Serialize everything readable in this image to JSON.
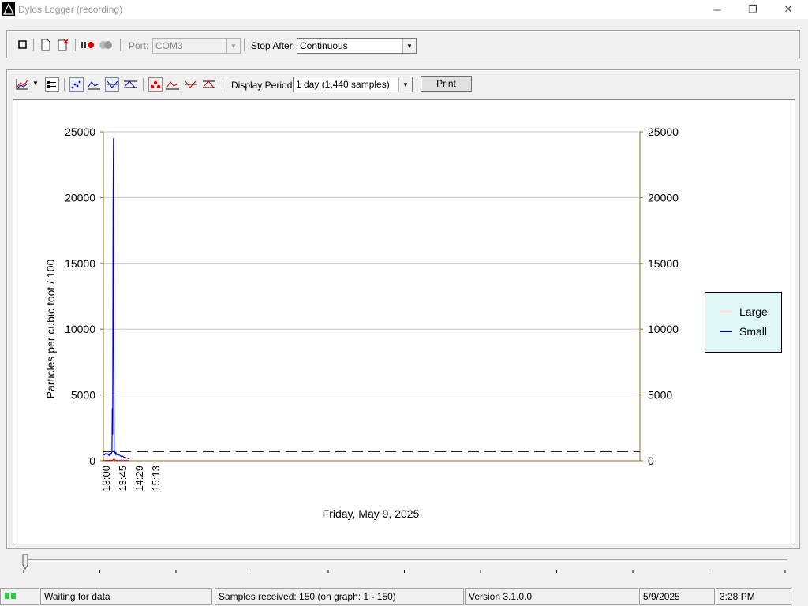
{
  "window": {
    "title": "Dylos Logger (recording)",
    "minimize_glyph": "─",
    "restore_glyph": "❐",
    "close_glyph": "✕"
  },
  "toolbar1": {
    "port_label": "Port:",
    "port_value": "COM3",
    "stop_after_label": "Stop After:",
    "stop_after_value": "Continuous",
    "icons": [
      "stop-icon",
      "new-file-icon",
      "delete-file-icon",
      "record-pause-icon",
      "connect-icon"
    ]
  },
  "toolbar2": {
    "display_period_label": "Display Period:",
    "display_period_value": "1 day (1,440 samples)",
    "print_label": "Print",
    "icons": [
      "chart-type-icon",
      "legend-icon",
      "scatter-blue-icon",
      "line-blue-icon",
      "line-blue-alt-icon",
      "line-blue-both-icon",
      "scatter-red-icon",
      "line-red-icon",
      "line-red-alt-icon",
      "line-red-both-icon"
    ]
  },
  "chart_data": {
    "type": "line",
    "ylabel": "Particles per cubic foot / 100",
    "xlabel": "Friday, May 9, 2025",
    "ylim": [
      0,
      25000
    ],
    "y_ticks": [
      0,
      5000,
      10000,
      15000,
      20000,
      25000
    ],
    "x_tick_labels": [
      "13:00",
      "13:45",
      "14:29",
      "15:13"
    ],
    "x_range_samples": [
      0,
      1440
    ],
    "threshold_line": 700,
    "legend_position": "right",
    "grid": true,
    "series": [
      {
        "name": "Large",
        "color": "#ff0000",
        "x": [
          0,
          10,
          20,
          25,
          28,
          30,
          33,
          36,
          40,
          50,
          60,
          70
        ],
        "y": [
          20,
          25,
          30,
          40,
          120,
          60,
          30,
          25,
          20,
          15,
          15,
          15
        ]
      },
      {
        "name": "Small",
        "color": "#0000cc",
        "x": [
          0,
          3,
          6,
          9,
          12,
          15,
          18,
          21,
          23,
          24,
          25,
          26,
          27,
          28,
          29,
          30,
          31,
          32,
          33,
          34,
          36,
          38,
          40,
          43,
          46,
          49,
          52,
          55,
          58,
          61,
          64,
          67,
          70
        ],
        "y": [
          500,
          450,
          550,
          480,
          520,
          400,
          600,
          500,
          700,
          4000,
          2000,
          19000,
          24500,
          8000,
          900,
          600,
          700,
          550,
          500,
          600,
          450,
          500,
          480,
          420,
          380,
          300,
          350,
          280,
          250,
          220,
          200,
          180,
          150
        ]
      }
    ]
  },
  "statusbar": {
    "state": "Waiting for data",
    "samples": "Samples received: 150  (on graph: 1 - 150)",
    "version": "Version 3.1.0.0",
    "date": "5/9/2025",
    "time": "3:28 PM"
  }
}
